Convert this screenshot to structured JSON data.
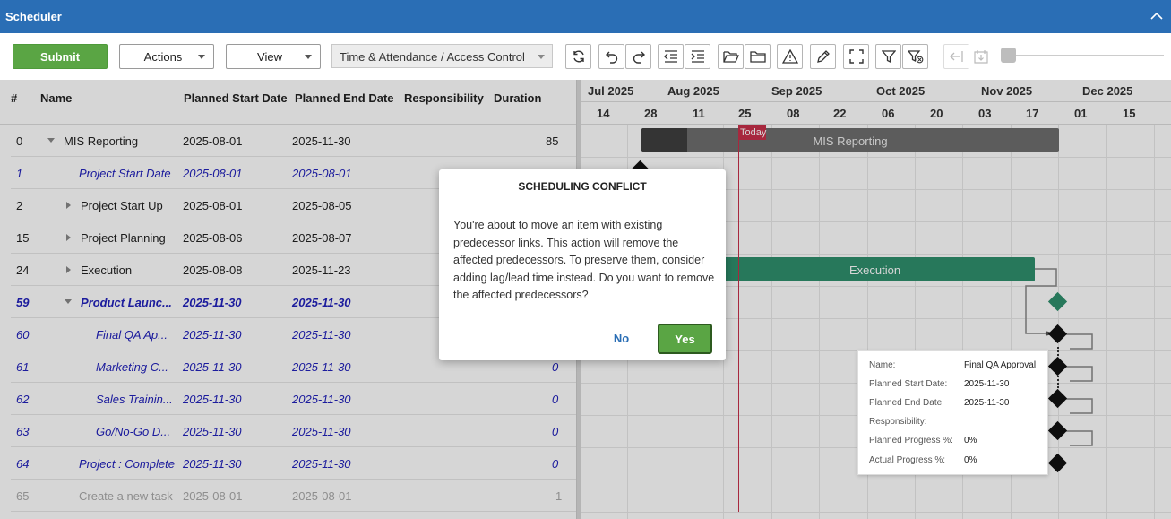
{
  "window": {
    "title": "Scheduler"
  },
  "toolbar": {
    "submit_label": "Submit",
    "actions_label": "Actions",
    "view_label": "View",
    "project_select": "Time & Attendance / Access Control"
  },
  "grid": {
    "headers": {
      "num": "#",
      "name": "Name",
      "start": "Planned Start Date",
      "end": "Planned End Date",
      "resp": "Responsibility",
      "dur": "Duration"
    },
    "rows": [
      {
        "num": "0",
        "name": "MIS Reporting",
        "start": "2025-08-01",
        "end": "2025-11-30",
        "dur": "85"
      },
      {
        "num": "1",
        "name": "Project Start Date",
        "start": "2025-08-01",
        "end": "2025-08-01",
        "dur": ""
      },
      {
        "num": "2",
        "name": "Project Start Up",
        "start": "2025-08-01",
        "end": "2025-08-05",
        "dur": ""
      },
      {
        "num": "15",
        "name": "Project Planning",
        "start": "2025-08-06",
        "end": "2025-08-07",
        "dur": ""
      },
      {
        "num": "24",
        "name": "Execution",
        "start": "2025-08-08",
        "end": "2025-11-23",
        "dur": ""
      },
      {
        "num": "59",
        "name": "Product Launc...",
        "start": "2025-11-30",
        "end": "2025-11-30",
        "dur": ""
      },
      {
        "num": "60",
        "name": "Final QA Ap...",
        "start": "2025-11-30",
        "end": "2025-11-30",
        "dur": ""
      },
      {
        "num": "61",
        "name": "Marketing C...",
        "start": "2025-11-30",
        "end": "2025-11-30",
        "dur": "0"
      },
      {
        "num": "62",
        "name": "Sales Trainin...",
        "start": "2025-11-30",
        "end": "2025-11-30",
        "dur": "0"
      },
      {
        "num": "63",
        "name": "Go/No-Go D...",
        "start": "2025-11-30",
        "end": "2025-11-30",
        "dur": "0"
      },
      {
        "num": "64",
        "name": "Project : Complete",
        "start": "2025-11-30",
        "end": "2025-11-30",
        "dur": "0"
      },
      {
        "num": "65",
        "name": "Create a new task",
        "start": "2025-08-01",
        "end": "2025-08-01",
        "dur": "1"
      }
    ]
  },
  "timeline": {
    "months": [
      "Jul 2025",
      "Aug 2025",
      "Sep 2025",
      "Oct 2025",
      "Nov 2025",
      "Dec 2025"
    ],
    "days": [
      "14",
      "28",
      "11",
      "25",
      "08",
      "22",
      "06",
      "20",
      "03",
      "17",
      "01",
      "15"
    ],
    "today_label": "Today",
    "bars": {
      "mis": "MIS Reporting",
      "execution": "Execution"
    },
    "mis_progress_pct": 11,
    "colors": {
      "accent": "#2a6eb5",
      "submit": "#5aa544",
      "today": "#c8304a",
      "execution": "#2f8f6d",
      "summary": "#6e6e6e"
    }
  },
  "tooltip": {
    "name_k": "Name:",
    "name_v": "Final QA Approval",
    "start_k": "Planned Start Date:",
    "start_v": "2025-11-30",
    "end_k": "Planned End Date:",
    "end_v": "2025-11-30",
    "resp_k": "Responsibility:",
    "resp_v": "",
    "pp_k": "Planned Progress %:",
    "pp_v": "0%",
    "ap_k": "Actual Progress %:",
    "ap_v": "0%"
  },
  "dialog": {
    "title": "SCHEDULING CONFLICT",
    "body": "You're about to move an item with existing predecessor links. This action will remove the affected predecessors. To preserve them, consider adding lag/lead time instead. Do you want to remove the affected predecessors?",
    "no_label": "No",
    "yes_label": "Yes"
  },
  "icons": [
    "refresh-icon",
    "undo-icon",
    "redo-icon",
    "outdent-icon",
    "indent-icon",
    "folder-open-icon",
    "folder-icon",
    "warning-icon",
    "pencil-icon",
    "fullscreen-icon",
    "filter-icon",
    "clear-filter-icon",
    "back-icon",
    "calendar-down-icon",
    "chevron-up-icon"
  ]
}
